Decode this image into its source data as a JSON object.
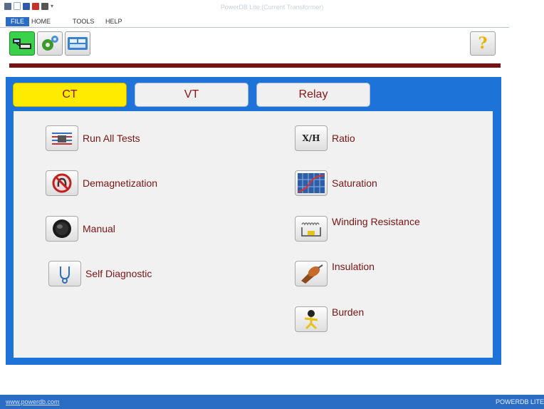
{
  "window": {
    "title": "PowerDB Lite (Current Transformer)"
  },
  "menu": {
    "file": "FILE",
    "home": "HOME",
    "tools": "TOOLS",
    "help": "HELP"
  },
  "toolbar": {
    "buttons": [
      {
        "icon": "test-set-icon",
        "active": true
      },
      {
        "icon": "settings-gears-icon",
        "active": false
      },
      {
        "icon": "instrument-panel-icon",
        "active": false
      }
    ],
    "help_label": "?"
  },
  "tabs": [
    {
      "label": "CT",
      "selected": true
    },
    {
      "label": "VT",
      "selected": false
    },
    {
      "label": "Relay",
      "selected": false
    }
  ],
  "tests": {
    "left": [
      {
        "label": "Run All Tests",
        "icon": "run-all-tests-icon"
      },
      {
        "label": "Demagnetization",
        "icon": "demagnetization-icon"
      },
      {
        "label": "Manual",
        "icon": "manual-knob-icon"
      },
      {
        "label": "Self Diagnostic",
        "icon": "stethoscope-icon"
      }
    ],
    "right": [
      {
        "label": "Ratio",
        "icon": "ratio-icon",
        "icon_text": "X/H"
      },
      {
        "label": "Saturation",
        "icon": "saturation-curve-icon"
      },
      {
        "label": "Winding Resistance",
        "icon": "winding-resistance-icon"
      },
      {
        "label": "Insulation",
        "icon": "insulation-probe-icon"
      },
      {
        "label": "Burden",
        "icon": "burden-icon"
      }
    ]
  },
  "footer": {
    "link": "www.powerdb.com",
    "brand": "POWERDB LITE"
  },
  "colors": {
    "accent": "#1e73d8",
    "tab_selected": "#ffeb00",
    "label": "#7a1414",
    "divider": "#7a1414",
    "footer": "#2b6cc4"
  }
}
